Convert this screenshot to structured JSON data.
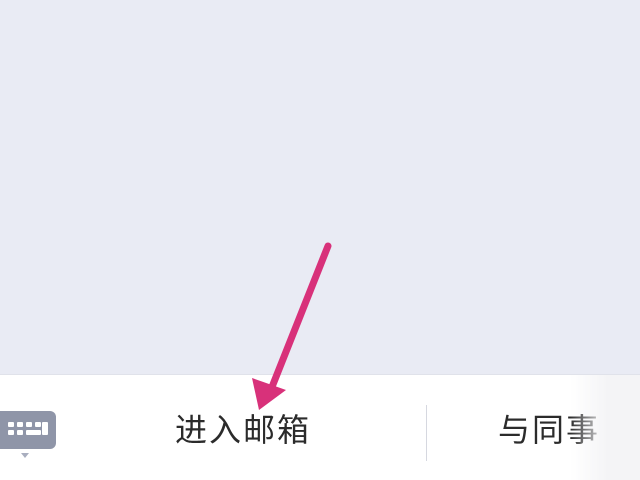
{
  "menu": {
    "items": [
      {
        "label": "进入邮箱"
      },
      {
        "label": "与同事"
      }
    ]
  },
  "icons": {
    "keyboard": "keyboard-icon"
  },
  "colors": {
    "background": "#e9ebf4",
    "bar": "#ffffff",
    "arrow": "#d8317a",
    "keyboard": "#8f95a8"
  }
}
